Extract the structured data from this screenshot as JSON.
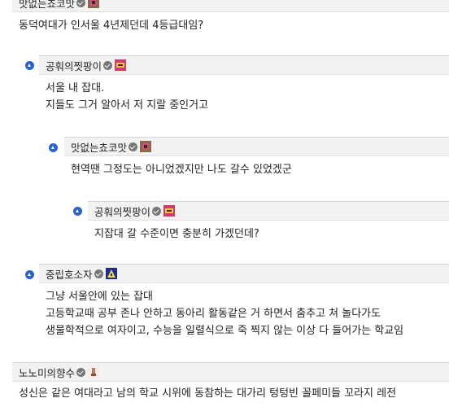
{
  "comments": [
    {
      "nick": "맛없는쵸코맛",
      "lines": [
        "동덕여대가 인서울 4년제던데 4등급대임?"
      ]
    },
    {
      "nick": "공훠의찟팡이",
      "lines": [
        "서울 내 잡대.",
        "지들도 그거 알아서 저 지랄 중인거고"
      ]
    },
    {
      "nick": "맛없는쵸코맛",
      "lines": [
        "현역땐 그정도는 아니었겠지만 나도 갈수 있었겠군"
      ]
    },
    {
      "nick": "공훠의찟팡이",
      "lines": [
        "지잡대 갈 수준이면 충분히 가겠던데?"
      ]
    },
    {
      "nick": "중립호소자",
      "lines": [
        "그냥 서울안에 있는 잡대",
        "고등학교때 공부 존나 안하고 동아리 활동같은 거 하면서 춤추고 쳐 놀다가도",
        "생물학적으로 여자이고, 수능을 일렬식으로 죽 찍지 않는 이상 다 들어가는 학교임"
      ]
    },
    {
      "nick": "노노미의향수",
      "lines": [
        "성신은 같은 여대라고 남의 학교 시위에 동참하는 대가리 텅텅빈 꼴페미들 꼬라지 레전"
      ]
    }
  ]
}
